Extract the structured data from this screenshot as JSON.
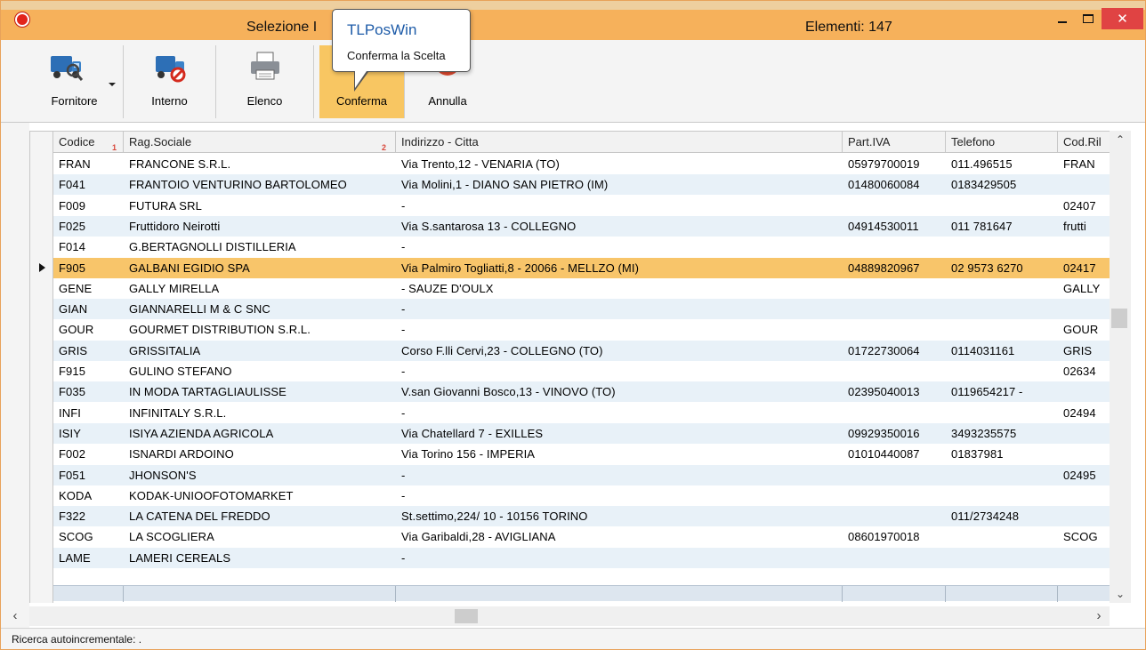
{
  "window": {
    "title": "Selezione I",
    "count": "Elementi: 147",
    "close_label": "✕"
  },
  "tooltip": {
    "title": "TLPosWin",
    "body": "Conferma la Scelta"
  },
  "toolbar": {
    "buttons": [
      {
        "label": "Fornitore"
      },
      {
        "label": "Interno"
      },
      {
        "label": "Elenco"
      },
      {
        "label": "Conferma"
      },
      {
        "label": "Annulla"
      }
    ]
  },
  "grid": {
    "columns": [
      "Codice",
      "Rag.Sociale",
      "Indirizzo - Citta",
      "Part.IVA",
      "Telefono",
      "Cod.Ril"
    ],
    "sort_marks": [
      "1",
      "2"
    ],
    "rows": [
      [
        "FRAN",
        "FRANCONE S.R.L.",
        "Via Trento,12 - VENARIA (TO)",
        "05979700019",
        "011.496515",
        "FRAN"
      ],
      [
        "F041",
        "FRANTOIO VENTURINO BARTOLOMEO",
        "Via Molini,1  - DIANO SAN PIETRO (IM)",
        "01480060084",
        "0183429505",
        ""
      ],
      [
        "F009",
        "FUTURA SRL",
        "-",
        "",
        "",
        "02407"
      ],
      [
        "F025",
        "Fruttidoro Neirotti",
        "Via S.santarosa 13 - COLLEGNO",
        "04914530011",
        "011 781647",
        "frutti"
      ],
      [
        "F014",
        "G.BERTAGNOLLI DISTILLERIA",
        "-",
        "",
        "",
        ""
      ],
      [
        "F905",
        "GALBANI EGIDIO SPA",
        "Via Palmiro Togliatti,8  - 20066 - MELLZO (MI)",
        "04889820967",
        "02 9573 6270",
        "02417"
      ],
      [
        "GENE",
        "GALLY MIRELLA",
        " - SAUZE D'OULX",
        "",
        "",
        "GALLY"
      ],
      [
        "GIAN",
        "GIANNARELLI M & C SNC",
        "-",
        "",
        "",
        ""
      ],
      [
        "GOUR",
        "GOURMET DISTRIBUTION S.R.L.",
        "-",
        "",
        "",
        "GOUR"
      ],
      [
        "GRIS",
        "GRISSITALIA",
        "Corso F.lli Cervi,23  - COLLEGNO  (TO)",
        "01722730064",
        "0114031161",
        "GRIS"
      ],
      [
        "F915",
        "GULINO STEFANO",
        "-",
        "",
        "",
        "02634"
      ],
      [
        "F035",
        "IN MODA TARTAGLIAULISSE",
        "V.san Giovanni Bosco,13  - VINOVO  (TO)",
        "02395040013",
        "0119654217 -",
        ""
      ],
      [
        "INFI",
        "INFINITALY S.R.L.",
        "-",
        "",
        "",
        "02494"
      ],
      [
        "ISIY",
        "ISIYA AZIENDA AGRICOLA",
        "Via Chatellard 7 - EXILLES",
        "09929350016",
        "3493235575",
        ""
      ],
      [
        "F002",
        "ISNARDI ARDOINO",
        "Via Torino 156 - IMPERIA",
        "01010440087",
        "01837981",
        ""
      ],
      [
        "F051",
        "JHONSON'S",
        "-",
        "",
        "",
        "02495"
      ],
      [
        "KODA",
        "KODAK-UNIOOFOTOMARKET",
        "-",
        "",
        "",
        ""
      ],
      [
        "F322",
        "LA CATENA DEL FREDDO",
        "St.settimo,224/ 10 - 10156 TORINO",
        "",
        "011/2734248",
        ""
      ],
      [
        "SCOG",
        "LA SCOGLIERA",
        "Via Garibaldi,28  - AVIGLIANA",
        "08601970018",
        "",
        "SCOG"
      ],
      [
        "LAME",
        "LAMERI CEREALS",
        "-",
        "",
        "",
        ""
      ]
    ],
    "selected_index": 5
  },
  "status": {
    "text": "Ricerca autoincrementale:   ."
  },
  "colors": {
    "title_bar": "#f6b15b",
    "selected_row": "#f8c56a",
    "alt_row": "#e8f1f8",
    "close_button": "#e04343",
    "tooltip_title": "#1d5ba8"
  }
}
